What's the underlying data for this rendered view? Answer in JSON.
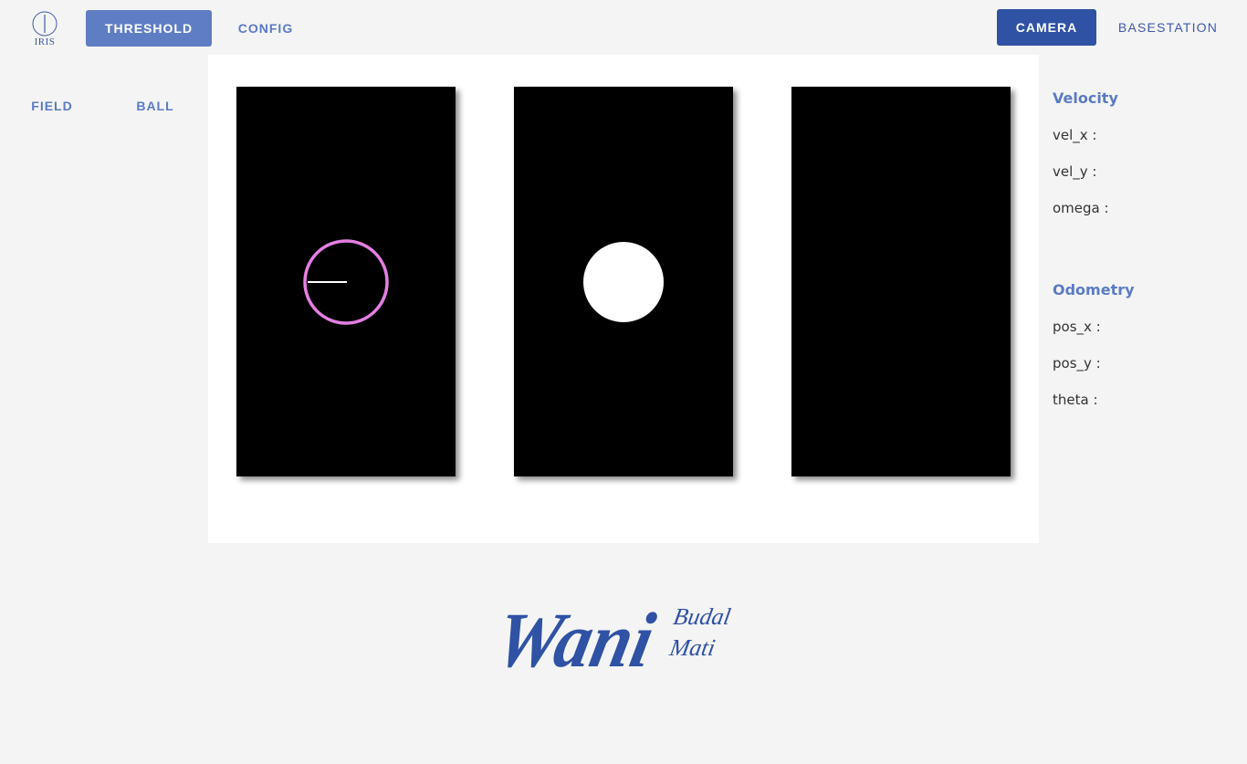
{
  "app": {
    "logo_text": "IRIS"
  },
  "nav": {
    "threshold": "THRESHOLD",
    "config": "CONFIG",
    "camera": "CAMERA",
    "basestation": "BASESTATION"
  },
  "subnav": {
    "field": "FIELD",
    "ball": "BALL"
  },
  "velocity": {
    "title": "Velocity",
    "vel_x": "vel_x :",
    "vel_y": "vel_y :",
    "omega": "omega :"
  },
  "odometry": {
    "title": "Odometry",
    "pos_x": "pos_x :",
    "pos_y": "pos_y :",
    "theta": "theta :"
  },
  "signature": {
    "main": "Wani",
    "line1": "Budal",
    "line2": "Mati"
  },
  "colors": {
    "accent": "#5f7dc2",
    "primary": "#2f52a4",
    "detect_ring": "#e47fe3"
  }
}
